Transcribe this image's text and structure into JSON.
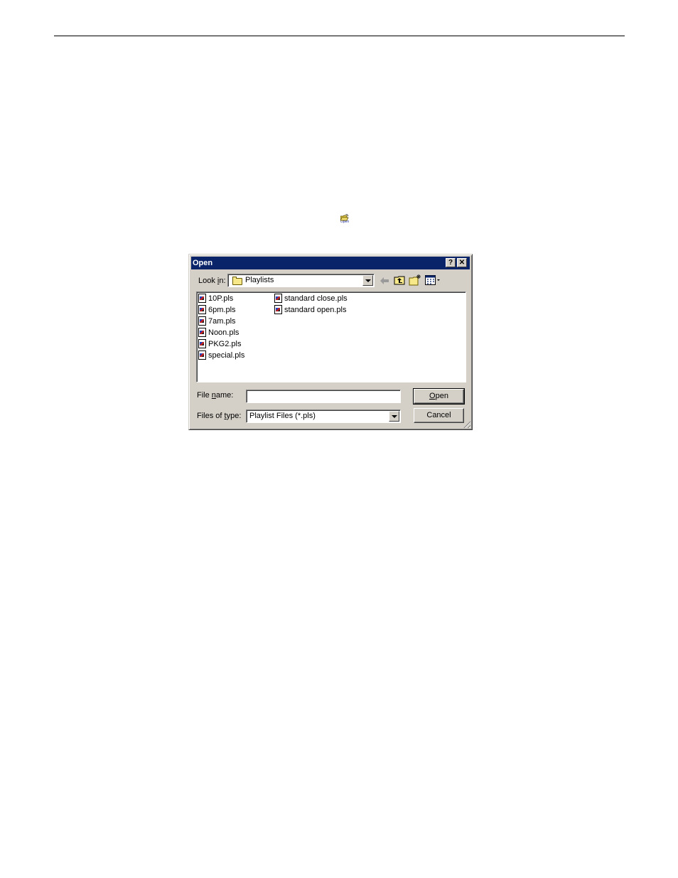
{
  "toolbar_icon": {
    "label": "Open",
    "icon": "open-folder-icon"
  },
  "dialog": {
    "title": "Open",
    "title_buttons": {
      "help": "?",
      "close": "✕"
    },
    "look_in": {
      "label_pre": "Look ",
      "label_ul": "i",
      "label_post": "n:",
      "value": "Playlists",
      "icon": "folder-icon"
    },
    "nav_icons": [
      "back-arrow-icon",
      "up-one-level-icon",
      "create-new-folder-icon",
      "view-menu-icon"
    ],
    "files": [
      {
        "name": "10P.pls",
        "column": 0,
        "row": 0
      },
      {
        "name": "6pm.pls",
        "column": 0,
        "row": 1
      },
      {
        "name": "7am.pls",
        "column": 0,
        "row": 2
      },
      {
        "name": "Noon.pls",
        "column": 0,
        "row": 3
      },
      {
        "name": "PKG2.pls",
        "column": 0,
        "row": 4
      },
      {
        "name": "special.pls",
        "column": 0,
        "row": 5
      },
      {
        "name": "standard close.pls",
        "column": 1,
        "row": 0
      },
      {
        "name": "standard open.pls",
        "column": 1,
        "row": 1
      }
    ],
    "file_name": {
      "label_pre": "File ",
      "label_ul": "n",
      "label_post": "ame:",
      "value": ""
    },
    "files_of_type": {
      "label_pre": "Files of ",
      "label_ul": "t",
      "label_post": "ype:",
      "value": "Playlist Files (*.pls)"
    },
    "open_button": {
      "label_ul": "O",
      "label_post": "pen"
    },
    "cancel_button": {
      "label": "Cancel"
    }
  }
}
